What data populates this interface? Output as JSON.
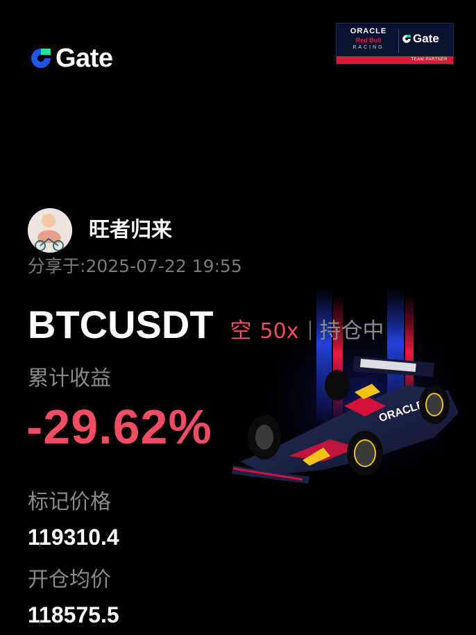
{
  "header": {
    "brand_name": "Gate",
    "brand_icon": "gate-logo-icon",
    "partner_badge": {
      "oracle": "ORACLE",
      "red_bull": "Red Bull",
      "racing": "RACING",
      "gate": "Gate",
      "team_partner": "TEAM PARTNER"
    }
  },
  "user": {
    "name": "旺者归来",
    "shared_label": "分享于:",
    "shared_time": "2025-07-22 19:55",
    "avatar_icon": "user-avatar"
  },
  "position": {
    "pair": "BTCUSDT",
    "direction": "空",
    "leverage": "50x",
    "status": "持仓中",
    "pnl_label": "累计收益",
    "pnl_value": "-29.62%",
    "mark_price_label": "标记价格",
    "mark_price": "119310.4",
    "entry_price_label": "开仓均价",
    "entry_price": "118575.5"
  },
  "colors": {
    "background": "#000000",
    "loss": "#ee4d63",
    "muted": "#8a8a8a",
    "brand_blue": "#2354e6",
    "brand_green": "#17e6a1",
    "badge_red": "#d51b36",
    "badge_navy": "#0c1330"
  }
}
